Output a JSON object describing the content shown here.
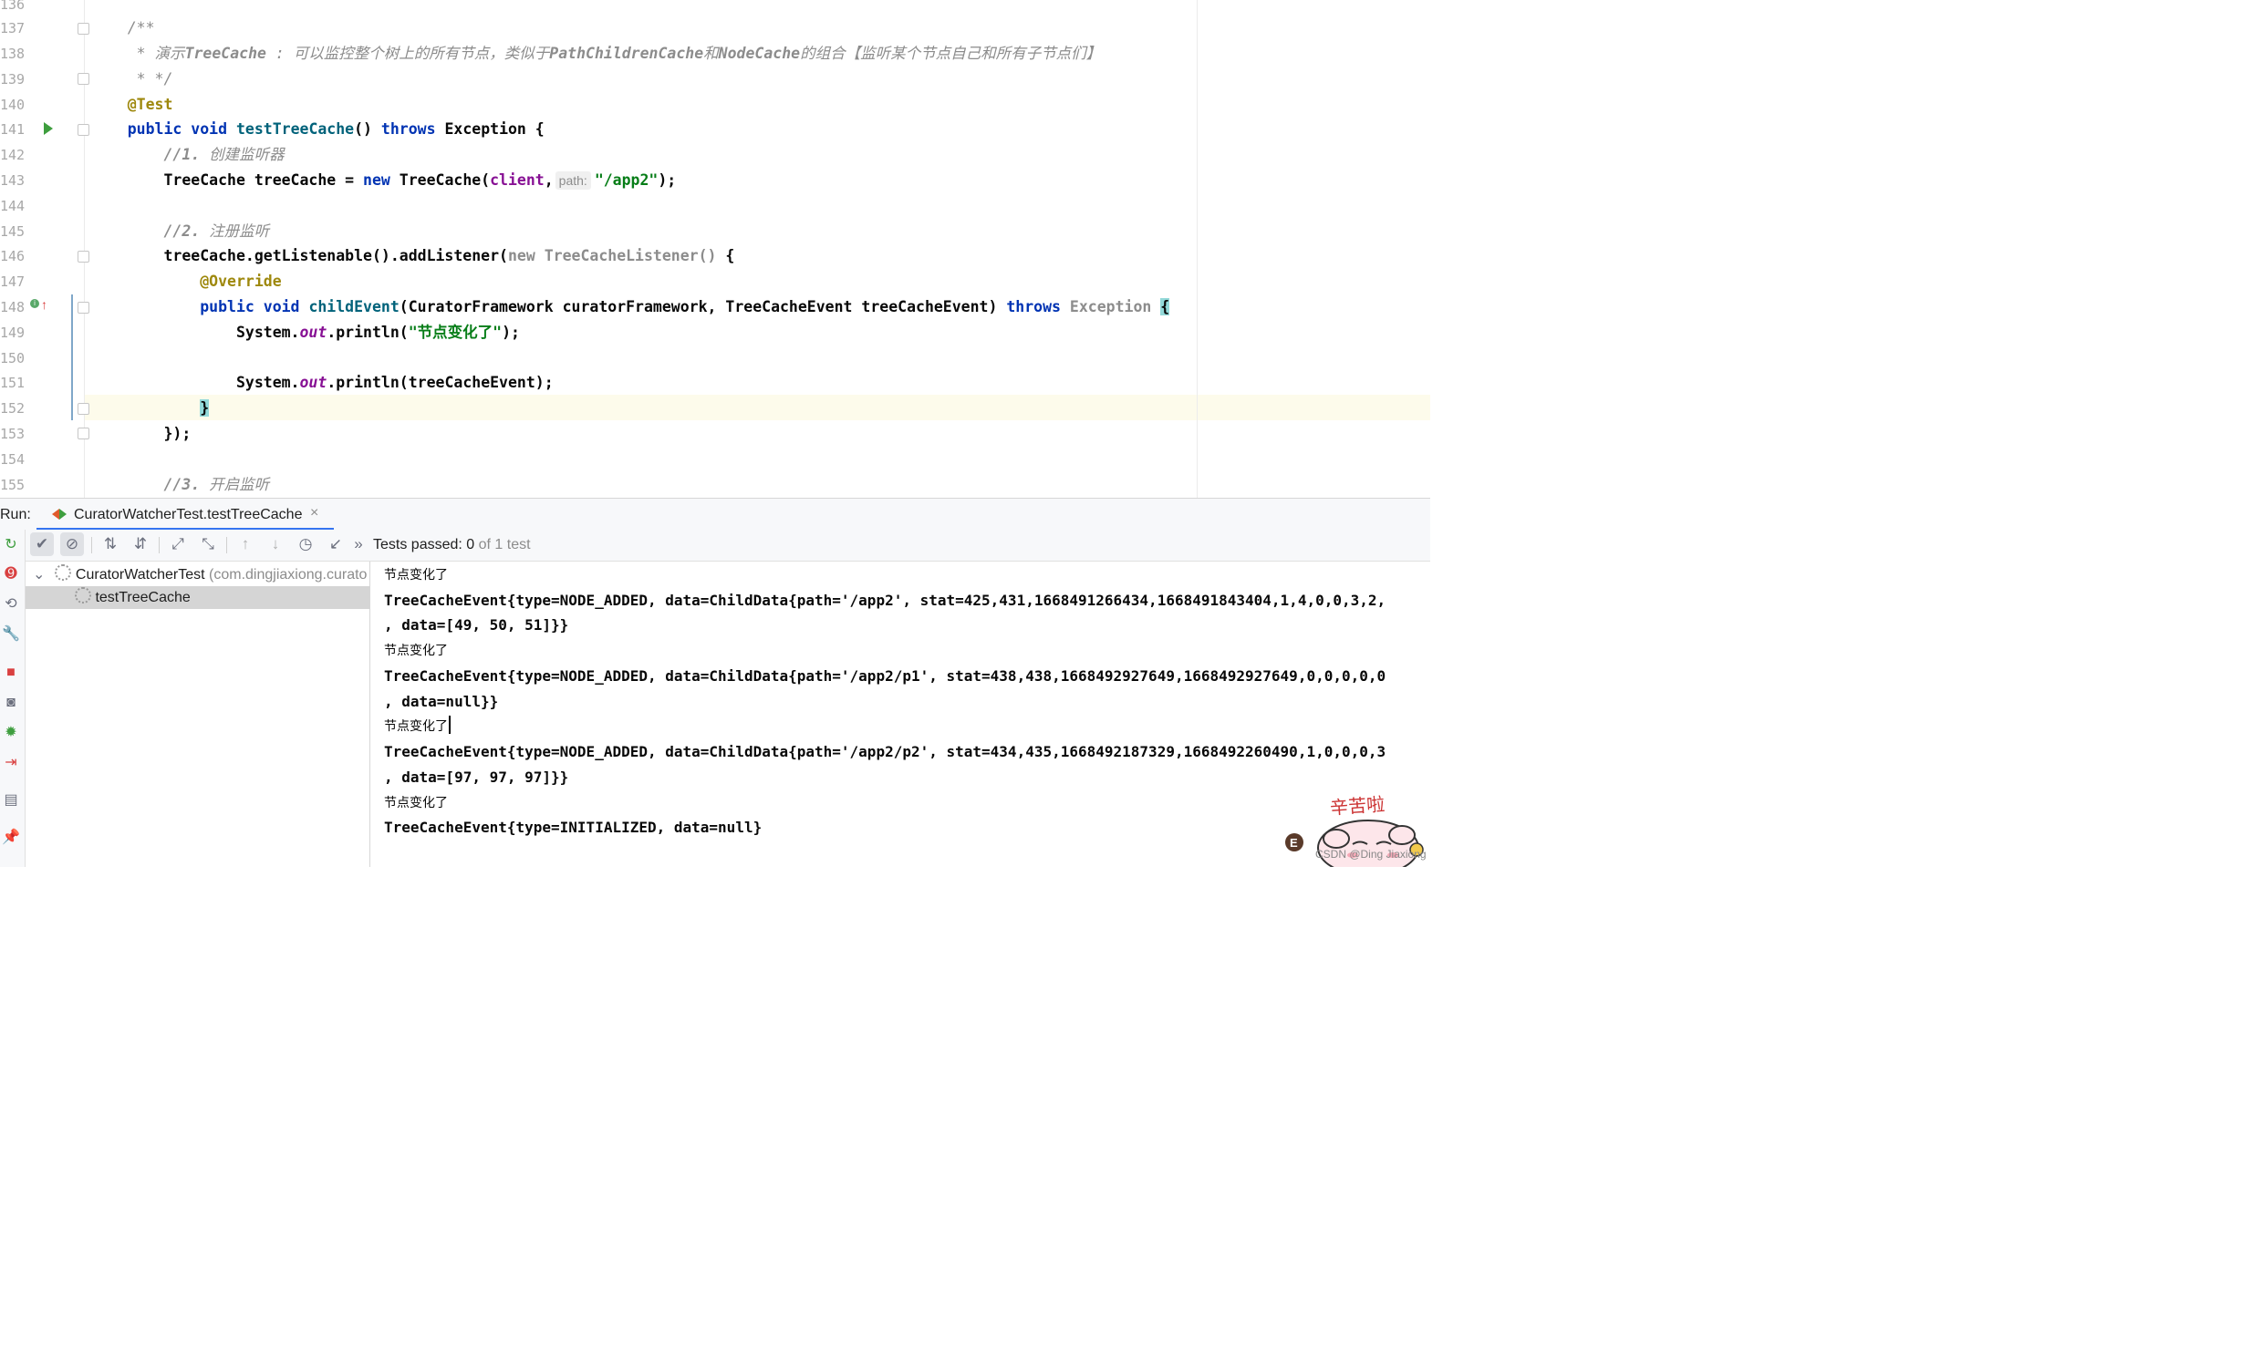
{
  "editor": {
    "line_numbers": [
      "136",
      "137",
      "138",
      "139",
      "140",
      "141",
      "142",
      "143",
      "144",
      "145",
      "146",
      "147",
      "148",
      "149",
      "150",
      "151",
      "152",
      "153",
      "154",
      "155"
    ],
    "l137": "/**",
    "l138_a": " * 演示",
    "l138_b": "TreeCache",
    "l138_c": " : 可以监控整个树上的所有节点，类似于",
    "l138_d": "PathChildrenCache",
    "l138_e": "和",
    "l138_f": "NodeCache",
    "l138_g": "的组合【监听某个节点自己和所有子节点们】",
    "l139": " * */",
    "l140": "@Test",
    "l141_kw1": "public void ",
    "l141_fn": "testTreeCache",
    "l141_b": "() ",
    "l141_kw2": "throws",
    "l141_c": " Exception {",
    "l142_a": "//1. ",
    "l142_b": "创建监听器",
    "l143_a": "TreeCache treeCache = ",
    "l143_kw": "new",
    "l143_b": " TreeCache(",
    "l143_fld": "client",
    "l143_c": ",",
    "l143_hint": "path:",
    "l143_str": "\"/app2\"",
    "l143_d": ");",
    "l145_a": "//2. ",
    "l145_b": "注册监听",
    "l146_a": "treeCache.getListenable().addListener(",
    "l146_gray": "new TreeCacheListener()",
    "l146_b": " {",
    "l147": "@Override",
    "l148_kw": "public void ",
    "l148_fn": "childEvent",
    "l148_a": "(CuratorFramework curatorFramework, TreeCacheEvent treeCacheEvent) ",
    "l148_kw2": "throws",
    "l148_gray": " Exception ",
    "l148_brace": "{",
    "l149_a": "System.",
    "l149_out": "out",
    "l149_b": ".println(",
    "l149_str": "\"节点变化了\"",
    "l149_c": ");",
    "l151_a": "System.",
    "l151_out": "out",
    "l151_b": ".println(treeCacheEvent);",
    "l152": "}",
    "l153": "});",
    "l155_a": "//3. ",
    "l155_b": "开启监听"
  },
  "run": {
    "label": "Run:",
    "tab_title": "CuratorWatcherTest.testTreeCache",
    "close": "×",
    "tests_passed_label": "Tests passed: ",
    "tests_passed_count": "0",
    "tests_passed_of": "of 1 test",
    "more": "»"
  },
  "tree": {
    "class_name": "CuratorWatcherTest",
    "package": "(com.dingjiaxiong.curato",
    "method": "testTreeCache"
  },
  "console": {
    "lines": [
      "节点变化了",
      "TreeCacheEvent{type=NODE_ADDED, data=ChildData{path='/app2', stat=425,431,1668491266434,1668491843404,1,4,0,0,3,2,",
      ", data=[49, 50, 51]}}",
      "节点变化了",
      "TreeCacheEvent{type=NODE_ADDED, data=ChildData{path='/app2/p1', stat=438,438,1668492927649,1668492927649,0,0,0,0,0",
      ", data=null}}",
      "节点变化了",
      "TreeCacheEvent{type=NODE_ADDED, data=ChildData{path='/app2/p2', stat=434,435,1668492187329,1668492260490,1,0,0,0,3",
      ", data=[97, 97, 97]}}",
      "节点变化了",
      "TreeCacheEvent{type=INITIALIZED, data=null}"
    ]
  },
  "sticker": {
    "text": "辛苦啦"
  },
  "watermark": "CSDN @Ding Jiaxiong",
  "colors": {
    "accent": "#3574f0",
    "keyword": "#0033b3",
    "string": "#067d17",
    "annotation": "#9e880d",
    "comment": "#8c8c8c"
  }
}
